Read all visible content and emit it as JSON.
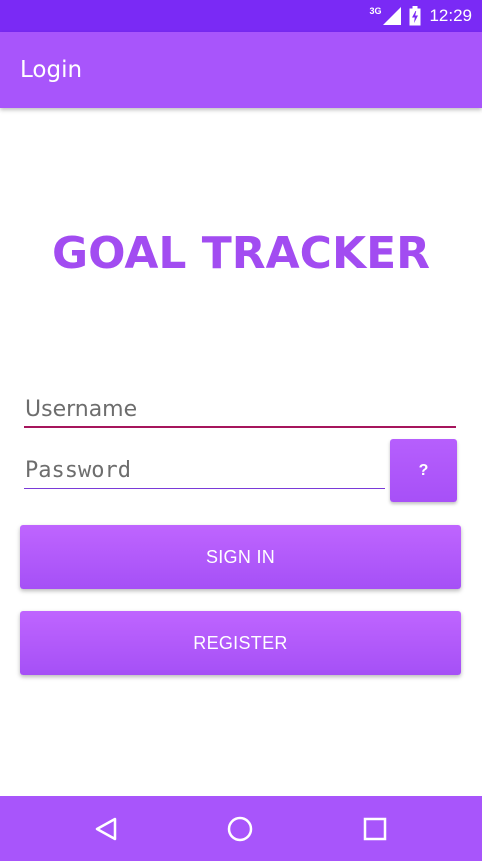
{
  "status_bar": {
    "network": "3G",
    "time": "12:29",
    "icons": [
      "signal-icon",
      "battery-icon"
    ]
  },
  "app_bar": {
    "title": "Login"
  },
  "main": {
    "app_name": "GOAL TRACKER",
    "username": {
      "value": "",
      "placeholder": "Username"
    },
    "password": {
      "value": "",
      "placeholder": "Password"
    },
    "help_label": "?",
    "signin_label": "SIGN IN",
    "register_label": "REGISTER"
  },
  "nav_bar": {
    "icons": [
      "back-icon",
      "home-icon",
      "recents-icon"
    ]
  },
  "colors": {
    "status_bar": "#7a2af5",
    "app_bar": "#a855fb",
    "accent": "#a24cf1",
    "button": "#b35cfd",
    "username_underline": "#a6155c"
  }
}
